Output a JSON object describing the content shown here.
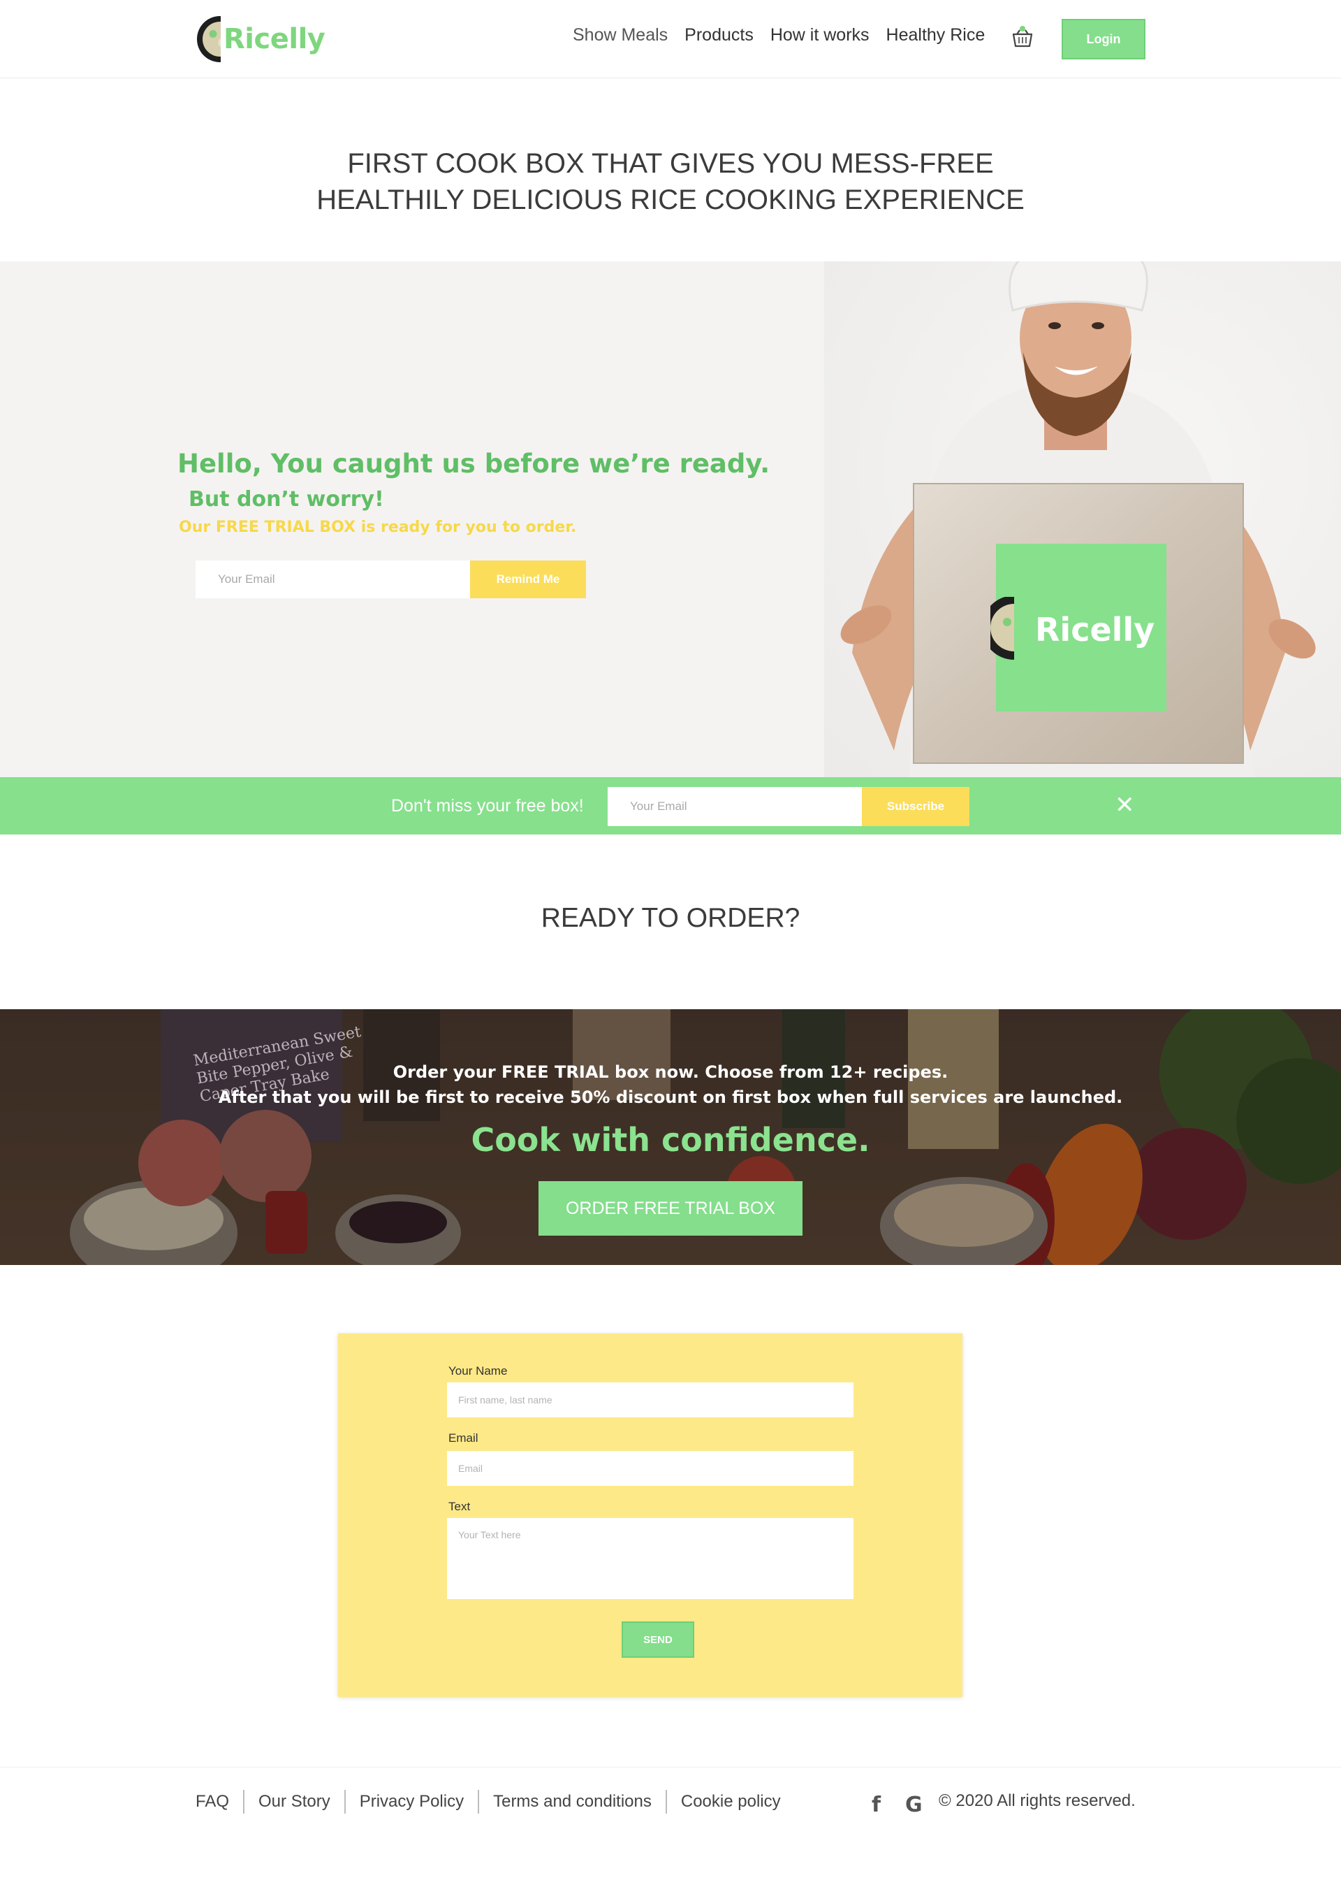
{
  "header": {
    "logo_text": "Ricelly",
    "nav": [
      "Show Meals",
      "Products",
      "How it works",
      "Healthy Rice"
    ],
    "login_label": "Login"
  },
  "headline": {
    "line1": "FIRST COOK BOX THAT GIVES YOU MESS-FREE",
    "line2": "HEALTHILY DELICIOUS RICE COOKING EXPERIENCE"
  },
  "hero": {
    "title": "Hello, You caught us before we’re ready.",
    "subtitle": "But don’t worry!",
    "note": "Our FREE TRIAL BOX is ready for you to order.",
    "email_placeholder": "Your Email",
    "button_label": "Remind Me",
    "box_logo_text": "Ricelly"
  },
  "subscribe_bar": {
    "label": "Don't miss your free box!",
    "email_placeholder": "Your Email",
    "button_label": "Subscribe",
    "close_glyph": "✕"
  },
  "ready": {
    "title": "READY TO ORDER?"
  },
  "promo": {
    "line1": "Order your FREE TRIAL box now. Choose from 12+ recipes.",
    "line2": "After that you will be first to receive 50% discount on first box when full services are launched.",
    "slogan": "Cook with confidence.",
    "button_label": "ORDER FREE TRIAL BOX",
    "package_text": "Mediterranean Sweet Bite Pepper, Olive & Caper Tray Bake"
  },
  "contact": {
    "name_label": "Your Name",
    "name_placeholder": "First name, last name",
    "email_label": "Email",
    "email_placeholder": "Email",
    "text_label": "Text",
    "text_placeholder": "Your Text here",
    "send_label": "SEND"
  },
  "footer": {
    "links": [
      "FAQ",
      "Our Story",
      "Privacy Policy",
      "Terms and conditions",
      "Cookie policy"
    ],
    "facebook_glyph": "f",
    "google_glyph": "G",
    "copyright": "© 2020 All rights reserved."
  },
  "colors": {
    "brand_green": "#84de8c",
    "text_green": "#5fbe66",
    "accent_yellow": "#fbdd5a",
    "form_yellow": "#fde987"
  },
  "icons": [
    "basket-icon",
    "close-icon",
    "facebook-icon",
    "google-icon"
  ]
}
